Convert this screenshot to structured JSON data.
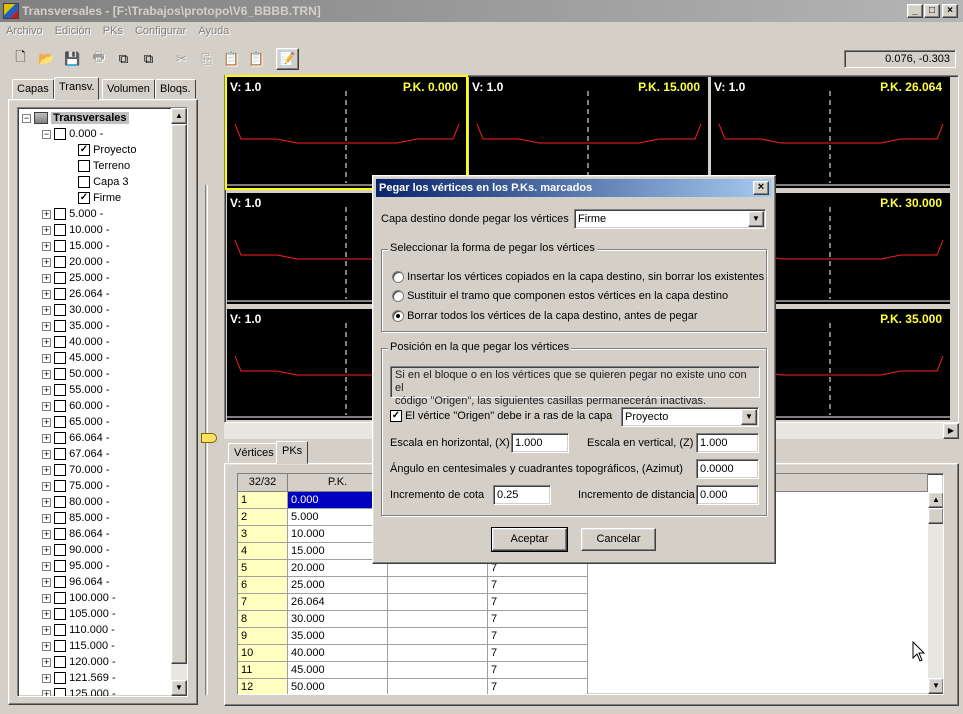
{
  "window": {
    "title": "Transversales - [F:\\Trabajos\\protopo\\V6_BBBB.TRN]"
  },
  "menu": [
    "Archivo",
    "Edición",
    "PKs",
    "Configurar",
    "Ayuda"
  ],
  "toolbar": {
    "icons": [
      "new-icon",
      "open-icon",
      "save-icon",
      "print-icon",
      "copy-layer-icon",
      "paste-layer-icon",
      "cut-icon",
      "copy-icon",
      "paste-icon",
      "paste-special-icon",
      "properties-icon"
    ]
  },
  "coords": "0.076, -0.303",
  "left_tabs": [
    "Capas",
    "Transv.",
    "Volumen",
    "Bloqs."
  ],
  "tree": {
    "root": "Transversales",
    "first_pk": "0.000 -",
    "layers": [
      {
        "label": "Proyecto",
        "checked": true
      },
      {
        "label": "Terreno",
        "checked": false
      },
      {
        "label": "Capa 3",
        "checked": false
      },
      {
        "label": "Firme",
        "checked": true
      }
    ],
    "pks": [
      "5.000 -",
      "10.000 -",
      "15.000 -",
      "20.000 -",
      "25.000 -",
      "26.064 -",
      "30.000 -",
      "35.000 -",
      "40.000 -",
      "45.000 -",
      "50.000 -",
      "55.000 -",
      "60.000 -",
      "65.000 -",
      "66.064 -",
      "67.064 -",
      "70.000 -",
      "75.000 -",
      "80.000 -",
      "85.000 -",
      "86.064 -",
      "90.000 -",
      "95.000 -",
      "96.064 -",
      "100.000 -",
      "105.000 -",
      "110.000 -",
      "115.000 -",
      "120.000 -",
      "121.569 -",
      "125.000 -"
    ]
  },
  "viewports": [
    {
      "v": "V: 1.0",
      "pk": "P.K. 0.000"
    },
    {
      "v": "V: 1.0",
      "pk": "P.K. 15.000"
    },
    {
      "v": "V: 1.0",
      "pk": "P.K. 26.064"
    },
    {
      "v": "V: 1.0",
      "pk": ""
    },
    {
      "v": "",
      "pk": "P.K. 30.000"
    },
    {
      "v": "V: 1.0",
      "pk": ""
    },
    {
      "v": "",
      "pk": "P.K. 35.000"
    }
  ],
  "bottom_tabs": [
    "Vértices",
    "PKs"
  ],
  "grid": {
    "counter": "32/32",
    "col_pk": "P.K.",
    "rows": [
      {
        "n": "1",
        "pk": "0.000",
        "c3": ""
      },
      {
        "n": "2",
        "pk": "5.000",
        "c3": ""
      },
      {
        "n": "3",
        "pk": "10.000",
        "c3": ""
      },
      {
        "n": "4",
        "pk": "15.000",
        "c3": ""
      },
      {
        "n": "5",
        "pk": "20.000",
        "c3": "7"
      },
      {
        "n": "6",
        "pk": "25.000",
        "c3": "7"
      },
      {
        "n": "7",
        "pk": "26.064",
        "c3": "7"
      },
      {
        "n": "8",
        "pk": "30.000",
        "c3": "7"
      },
      {
        "n": "9",
        "pk": "35.000",
        "c3": "7"
      },
      {
        "n": "10",
        "pk": "40.000",
        "c3": "7"
      },
      {
        "n": "11",
        "pk": "45.000",
        "c3": "7"
      },
      {
        "n": "12",
        "pk": "50.000",
        "c3": "7"
      }
    ]
  },
  "dialog": {
    "title": "Pegar los vértices en los P.Ks. marcados",
    "capa_label": "Capa destino donde pegar los vértices",
    "capa_value": "Firme",
    "group1_title": "Seleccionar la forma de pegar los vértices",
    "radios": [
      {
        "label": "Insertar los vértices copiados en la capa destino, sin borrar los existentes",
        "on": false
      },
      {
        "label": "Sustituir el tramo que componen estos vértices en la capa destino",
        "on": false
      },
      {
        "label": "Borrar todos los vértices de la capa destino, antes de pegar",
        "on": true
      }
    ],
    "group2_title": "Posición en la que pegar los vértices",
    "info_line1": "Si en  el bloque o en los  vértices que  se quieren  pegar no existe uno con el",
    "info_line2": "código \"Origen\", las siguientes casillas permanecerán inactivas.",
    "origen_label": "El vértice \"Origen\" debe ir a ras de la capa",
    "origen_value": "Proyecto",
    "escala_h_label": "Escala en horizontal, (X)",
    "escala_h": "1.000",
    "escala_v_label": "Escala en vertical, (Z)",
    "escala_v": "1.000",
    "angulo_label": "Ángulo en centesimales y cuadrantes topográficos, (Azimut)",
    "angulo": "0.0000",
    "inc_cota_label": "Incremento de cota",
    "inc_cota": "0.25",
    "inc_dist_label": "Incremento de distancia",
    "inc_dist": "0.000",
    "ok_label": "Aceptar",
    "cancel_label": "Cancelar"
  }
}
